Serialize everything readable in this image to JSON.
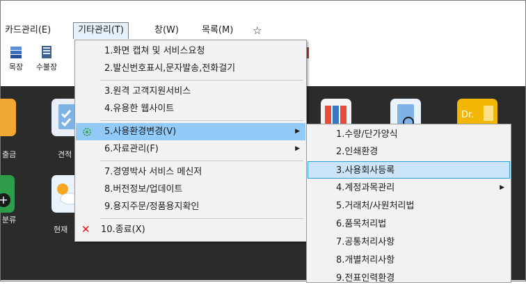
{
  "menubar": {
    "items": [
      {
        "label": "카드관리(E)"
      },
      {
        "label": "기타관리(T)"
      },
      {
        "label": "창(W)"
      },
      {
        "label": "목록(M)"
      }
    ],
    "star_icon": "☆"
  },
  "toolbar": {
    "buttons": [
      {
        "label": "목장"
      },
      {
        "label": "수불장"
      }
    ]
  },
  "desktop": {
    "tiles": [
      {
        "label": "출금"
      },
      {
        "label": "견적"
      },
      {
        "label": "분류"
      },
      {
        "label": "현재"
      },
      {
        "label": "Dr."
      }
    ]
  },
  "menu_main": {
    "items": [
      {
        "label": "1.화면 캡쳐 및 서비스요청"
      },
      {
        "label": "2.발신번호표시,문자발송,전화걸기"
      },
      {
        "label": "3.원격 고객지원서비스"
      },
      {
        "label": "4.유용한 웹사이트"
      },
      {
        "label": "5.사용환경변경(V)",
        "arrow": "▶"
      },
      {
        "label": "6.자료관리(F)",
        "arrow": "▶"
      },
      {
        "label": "7.경영박사 서비스 메신저"
      },
      {
        "label": "8.버전정보/업데이트"
      },
      {
        "label": "9.용지주문/정품용지확인"
      },
      {
        "label": "10.종료(X)"
      }
    ]
  },
  "menu_sub": {
    "items": [
      {
        "label": "1.수량/단가양식"
      },
      {
        "label": "2.인쇄환경"
      },
      {
        "label": "3.사용회사등록"
      },
      {
        "label": "4.계정과목관리",
        "arrow": "▶"
      },
      {
        "label": "5.거래처/사원처리법"
      },
      {
        "label": "6.품목처리법"
      },
      {
        "label": "7.공통처리사항"
      },
      {
        "label": "8.개별처리사항"
      },
      {
        "label": "9.전표인력환경"
      }
    ]
  },
  "colors": {
    "highlight": "#91c9f7",
    "selected": "#cce4f7",
    "close_x": "#e81123"
  }
}
